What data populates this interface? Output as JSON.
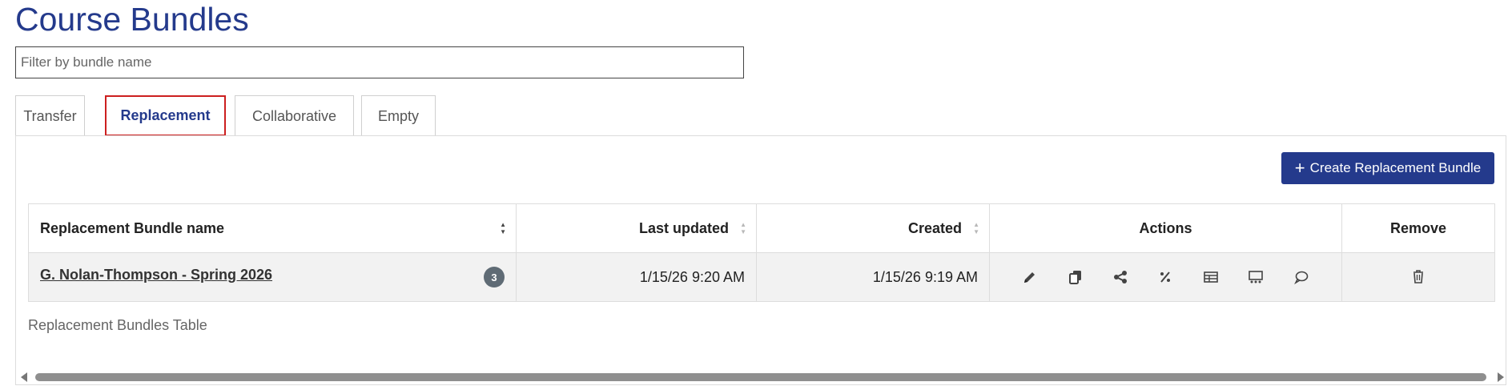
{
  "page": {
    "title": "Course Bundles"
  },
  "filter": {
    "placeholder": "Filter by bundle name",
    "value": ""
  },
  "tabs": [
    {
      "label": "Transfer",
      "active": false
    },
    {
      "label": "Replacement",
      "active": true
    },
    {
      "label": "Collaborative",
      "active": false
    },
    {
      "label": "Empty",
      "active": false
    }
  ],
  "toolbar": {
    "create_label": "Create Replacement Bundle",
    "create_icon": "plus-icon"
  },
  "table": {
    "caption": "Replacement Bundles Table",
    "columns": [
      {
        "label": "Replacement Bundle name",
        "sortable": true
      },
      {
        "label": "Last updated",
        "sortable": true
      },
      {
        "label": "Created",
        "sortable": true
      },
      {
        "label": "Actions",
        "sortable": false
      },
      {
        "label": "Remove",
        "sortable": false
      }
    ],
    "rows": [
      {
        "name": "G. Nolan-Thompson - Spring 2026",
        "count": "3",
        "last_updated": "1/15/26 9:20 AM",
        "created": "1/15/26 9:19 AM",
        "actions": [
          "edit-icon",
          "copy-icon",
          "share-icon",
          "percent-icon",
          "table-icon",
          "presentation-icon",
          "comment-icon"
        ],
        "remove_icon": "trash-icon"
      }
    ]
  },
  "colors": {
    "brand": "#243a8c",
    "active_tab_border": "#cc1f1f",
    "badge": "#5f6b75"
  }
}
